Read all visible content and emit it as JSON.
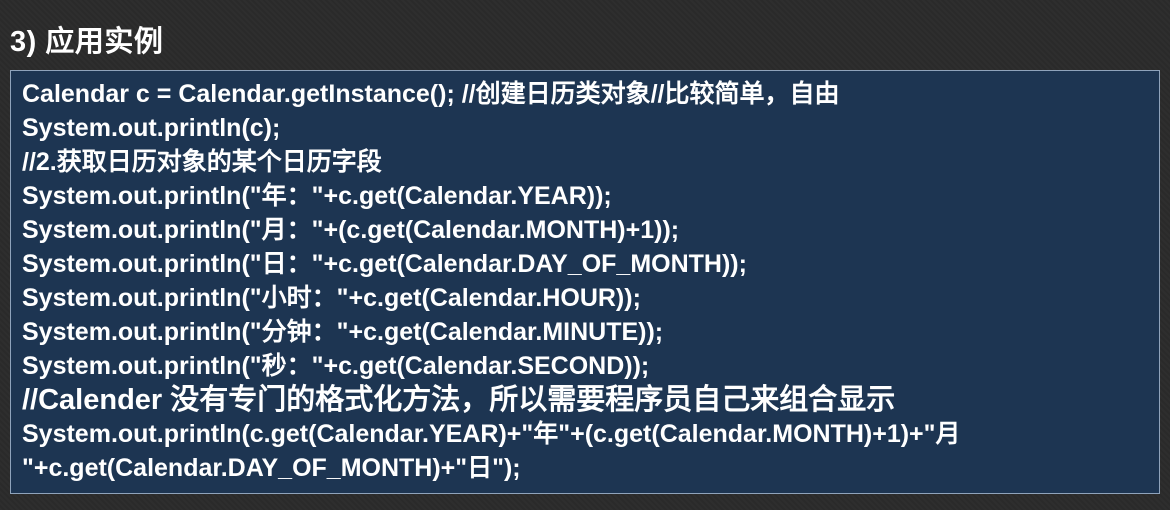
{
  "slide": {
    "title": "3) 应用实例"
  },
  "code": {
    "lines": [
      "Calendar c = Calendar.getInstance(); //创建日历类对象//比较简单，自由",
      "System.out.println(c);",
      "//2.获取日历对象的某个日历字段",
      "System.out.println(\"年：\"+c.get(Calendar.YEAR));",
      "System.out.println(\"月：\"+(c.get(Calendar.MONTH)+1));",
      "System.out.println(\"日：\"+c.get(Calendar.DAY_OF_MONTH));",
      "System.out.println(\"小时：\"+c.get(Calendar.HOUR));",
      "System.out.println(\"分钟：\"+c.get(Calendar.MINUTE));",
      "System.out.println(\"秒：\"+c.get(Calendar.SECOND));",
      "//Calender 没有专门的格式化方法，所以需要程序员自己来组合显示",
      "System.out.println(c.get(Calendar.YEAR)+\"年\"+(c.get(Calendar.MONTH)+1)+\"月",
      "\"+c.get(Calendar.DAY_OF_MONTH)+\"日\");"
    ]
  }
}
